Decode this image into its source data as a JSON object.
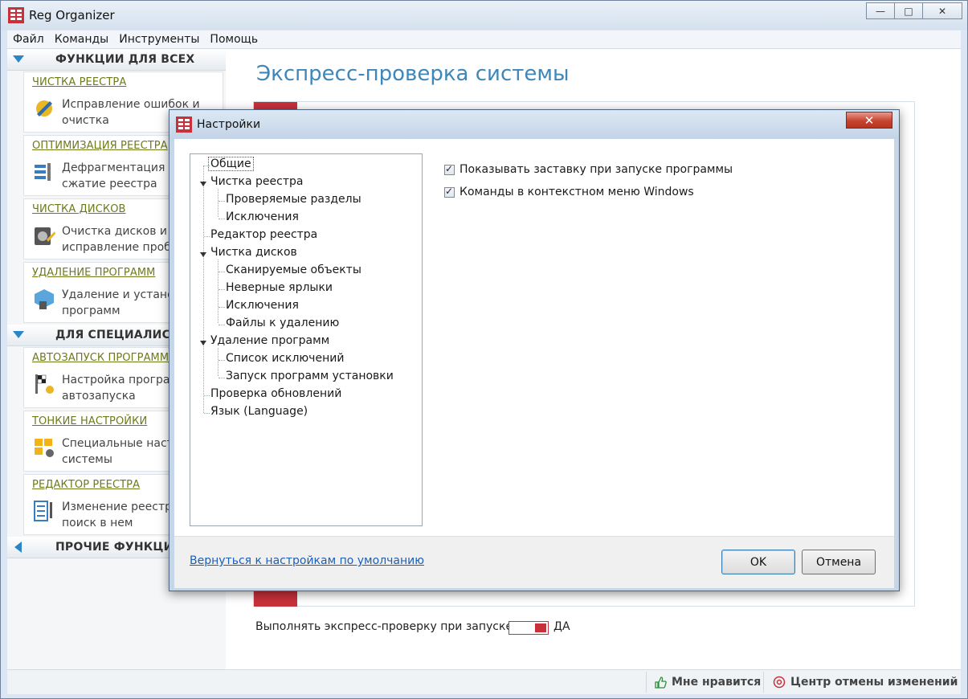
{
  "app": {
    "title": "Reg Organizer"
  },
  "menu": [
    "Файл",
    "Команды",
    "Инструменты",
    "Помощь"
  ],
  "sidebar": {
    "section1": "ФУНКЦИИ ДЛЯ ВСЕХ",
    "section2": "ДЛЯ СПЕЦИАЛИСТОВ",
    "section3": "ПРОЧИЕ ФУНКЦИИ",
    "tools": [
      {
        "title": "ЧИСТКА РЕЕСТРА",
        "desc": "Исправление ошибок и очистка",
        "icon": "registry-clean-icon"
      },
      {
        "title": "ОПТИМИЗАЦИЯ РЕЕСТРА",
        "desc": "Дефрагментация и сжатие реестра",
        "icon": "registry-optimize-icon"
      },
      {
        "title": "ЧИСТКА ДИСКОВ",
        "desc": "Очистка дисков и исправление проблем",
        "icon": "disk-clean-icon"
      },
      {
        "title": "УДАЛЕНИЕ ПРОГРАММ",
        "desc": "Удаление и установка программ",
        "icon": "uninstall-box-icon"
      },
      {
        "title": "АВТОЗАПУСК ПРОГРАММ",
        "desc": "Настройка программ автозапуска",
        "icon": "autorun-flag-icon"
      },
      {
        "title": "ТОНКИЕ НАСТРОЙКИ",
        "desc": "Специальные настройки системы",
        "icon": "windows-tweak-icon"
      },
      {
        "title": "РЕДАКТОР РЕЕСТРА",
        "desc": "Изменение реестра и поиск в нем",
        "icon": "registry-editor-icon"
      }
    ]
  },
  "main": {
    "title": "Экспресс-проверка системы",
    "express_label": "Выполнять экспресс-проверку при запуске:",
    "toggle_value": "ДА"
  },
  "statusbar": {
    "like": "Мне нравится",
    "undo": "Центр отмены изменений"
  },
  "dialog": {
    "title": "Настройки",
    "tree": [
      {
        "label": "Общие",
        "level": 0,
        "selected": true
      },
      {
        "label": "Чистка реестра",
        "level": 0,
        "expanded": true
      },
      {
        "label": "Проверяемые разделы",
        "level": 1
      },
      {
        "label": "Исключения",
        "level": 1
      },
      {
        "label": "Редактор реестра",
        "level": 0
      },
      {
        "label": "Чистка дисков",
        "level": 0,
        "expanded": true
      },
      {
        "label": "Сканируемые объекты",
        "level": 1
      },
      {
        "label": "Неверные ярлыки",
        "level": 1
      },
      {
        "label": "Исключения",
        "level": 1
      },
      {
        "label": "Файлы к удалению",
        "level": 1
      },
      {
        "label": "Удаление программ",
        "level": 0,
        "expanded": true
      },
      {
        "label": "Список исключений",
        "level": 1
      },
      {
        "label": "Запуск программ установки",
        "level": 1
      },
      {
        "label": "Проверка обновлений",
        "level": 0
      },
      {
        "label": "Язык (Language)",
        "level": 0
      }
    ],
    "options": [
      {
        "label": "Показывать заставку при запуске программы",
        "checked": true
      },
      {
        "label": "Команды в контекстном меню Windows",
        "checked": true
      }
    ],
    "reset_link": "Вернуться к настройкам по умолчанию",
    "ok": "OK",
    "cancel": "Отмена"
  },
  "colors": {
    "accent_red": "#c8303a",
    "title_blue": "#3f86b9",
    "tool_title": "#6e7a1a",
    "link": "#1d5fb6"
  }
}
